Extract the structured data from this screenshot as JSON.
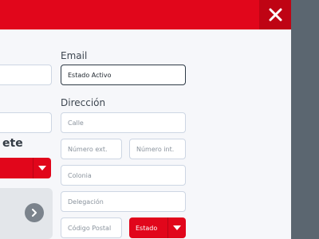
{
  "colors": {
    "accent": "#e1061b",
    "overlay": "#5b6670",
    "panel": "#f6f7fa"
  },
  "left_column": {
    "heading_fragment": "ete",
    "select": {
      "selected": "",
      "icon": "chevron-down-icon"
    },
    "card": {
      "icon": "chevron-right-icon"
    }
  },
  "email": {
    "label": "Email",
    "value": "Estado Activo"
  },
  "address": {
    "label": "Dirección",
    "street_placeholder": "Calle",
    "ext_number_placeholder": "Número ext.",
    "int_number_placeholder": "Número int.",
    "colony_placeholder": "Colonia",
    "delegation_placeholder": "Delegación",
    "postal_code_placeholder": "Código Postal",
    "state_select": {
      "selected": "Estado",
      "icon": "chevron-down-icon"
    }
  },
  "close_icon": "close-icon"
}
